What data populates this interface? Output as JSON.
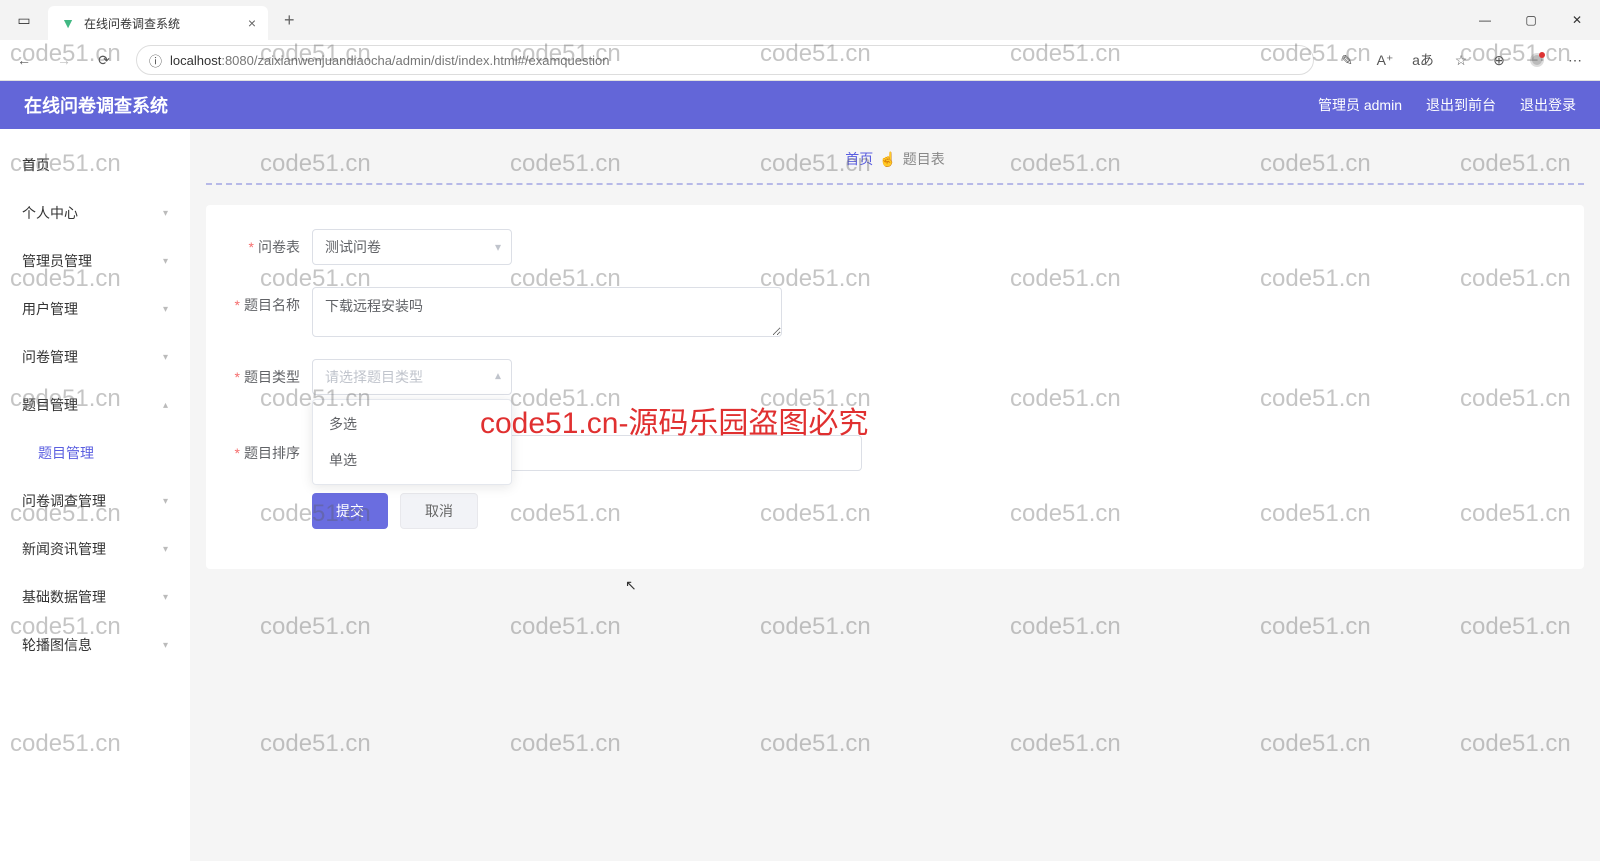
{
  "browser": {
    "tab_title": "在线问卷调查系统",
    "url_host": "localhost",
    "url_port": ":8080",
    "url_path": "/zaixianwenjuandiaocha/admin/dist/index.html#/examquestion"
  },
  "header": {
    "app_title": "在线问卷调查系统",
    "user_label": "管理员 admin",
    "to_front": "退出到前台",
    "logout": "退出登录"
  },
  "sidebar": {
    "items": [
      {
        "label": "首页",
        "expandable": false
      },
      {
        "label": "个人中心",
        "expandable": true
      },
      {
        "label": "管理员管理",
        "expandable": true
      },
      {
        "label": "用户管理",
        "expandable": true
      },
      {
        "label": "问卷管理",
        "expandable": true
      },
      {
        "label": "题目管理",
        "expandable": true,
        "sub": "题目管理"
      },
      {
        "label": "问卷调查管理",
        "expandable": true
      },
      {
        "label": "新闻资讯管理",
        "expandable": true
      },
      {
        "label": "基础数据管理",
        "expandable": true
      },
      {
        "label": "轮播图信息",
        "expandable": true
      }
    ]
  },
  "breadcrumb": {
    "home": "首页",
    "current": "题目表"
  },
  "form": {
    "paper_label": "问卷表",
    "paper_value": "测试问卷",
    "name_label": "题目名称",
    "name_value": "下载远程安装吗",
    "type_label": "题目类型",
    "type_placeholder": "请选择题目类型",
    "type_options": [
      "多选",
      "单选"
    ],
    "sort_label": "题目排序",
    "submit": "提交",
    "cancel": "取消"
  },
  "watermark": {
    "text": "code51.cn",
    "red": "code51.cn-源码乐园盗图必究"
  }
}
